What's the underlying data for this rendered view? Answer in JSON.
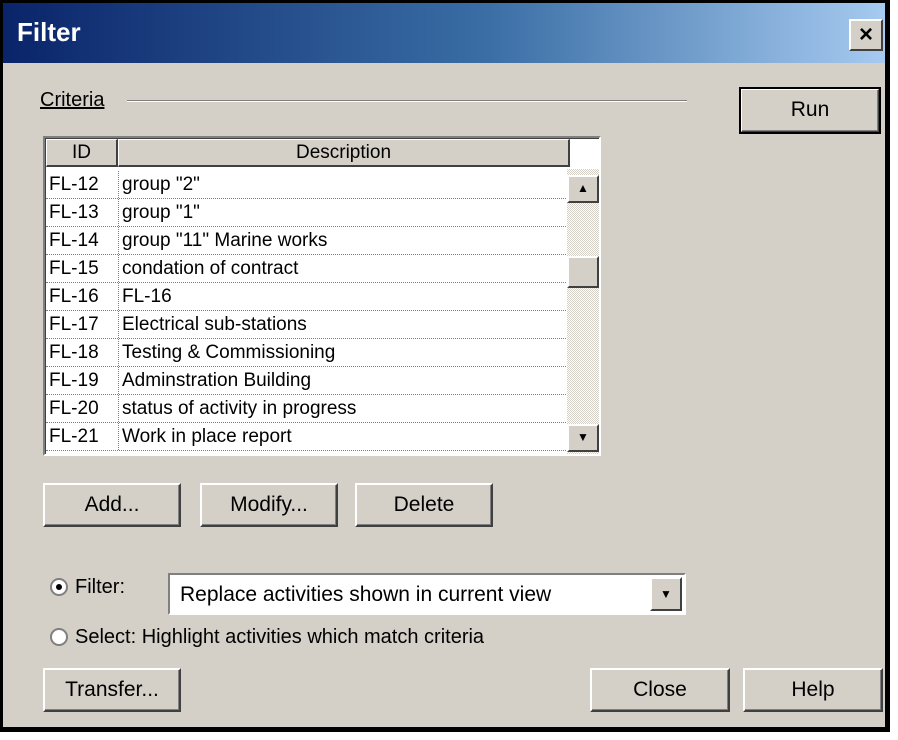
{
  "window": {
    "title": "Filter",
    "close_glyph": "×"
  },
  "criteria": {
    "label": "Criteria",
    "columns": [
      "ID",
      "Description"
    ],
    "rows": [
      {
        "id": "FL-12",
        "desc": "group \"2\""
      },
      {
        "id": "FL-13",
        "desc": "group \"1\""
      },
      {
        "id": "FL-14",
        "desc": "group \"11\"  Marine works"
      },
      {
        "id": "FL-15",
        "desc": "condation of contract"
      },
      {
        "id": "FL-16",
        "desc": "FL-16"
      },
      {
        "id": "FL-17",
        "desc": "Electrical sub-stations"
      },
      {
        "id": "FL-18",
        "desc": "Testing & Commissioning"
      },
      {
        "id": "FL-19",
        "desc": "Adminstration Building"
      },
      {
        "id": "FL-20",
        "desc": "status of activity in progress"
      },
      {
        "id": "FL-21",
        "desc": "Work in place report"
      }
    ],
    "scroll_up_glyph": "▲",
    "scroll_down_glyph": "▼"
  },
  "buttons": {
    "run": "Run",
    "add": "Add...",
    "modify": "Modify...",
    "delete": "Delete",
    "transfer": "Transfer...",
    "close": "Close",
    "help": "Help"
  },
  "mode": {
    "filter_label": "Filter:",
    "filter_selected": true,
    "filter_value": "Replace activities shown in current view",
    "select_label": "Select:  Highlight activities which match criteria",
    "dropdown_glyph": "▼"
  }
}
